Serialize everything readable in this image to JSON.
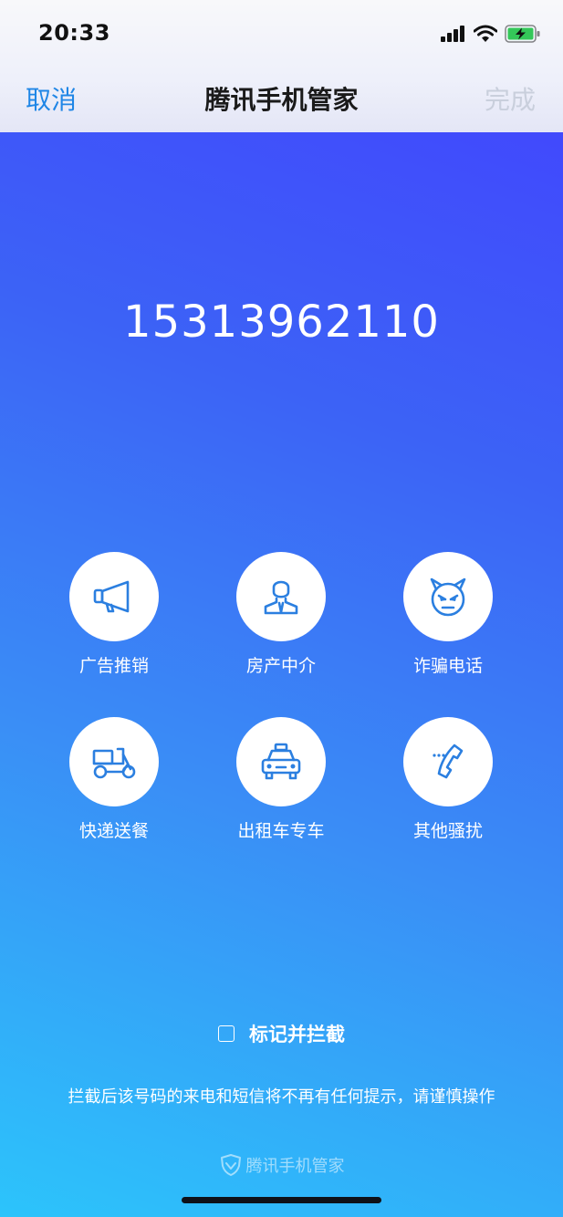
{
  "status": {
    "time": "20:33"
  },
  "nav": {
    "cancel": "取消",
    "title": "腾讯手机管家",
    "done": "完成"
  },
  "phone_number": "15313962110",
  "categories": [
    {
      "label": "广告推销",
      "icon": "megaphone-icon"
    },
    {
      "label": "房产中介",
      "icon": "agent-icon"
    },
    {
      "label": "诈骗电话",
      "icon": "devil-icon"
    },
    {
      "label": "快递送餐",
      "icon": "delivery-scooter-icon"
    },
    {
      "label": "出租车专车",
      "icon": "taxi-icon"
    },
    {
      "label": "其他骚扰",
      "icon": "phone-call-icon"
    }
  ],
  "mark": {
    "label": "标记并拦截",
    "checked": false
  },
  "warning": "拦截后该号码的来电和短信将不再有任何提示，请谨慎操作",
  "footer": {
    "brand": "腾讯手机管家"
  },
  "colors": {
    "accent": "#1f86e6",
    "icon_blue": "#2b7fe0",
    "disabled": "#c9cfdc"
  }
}
